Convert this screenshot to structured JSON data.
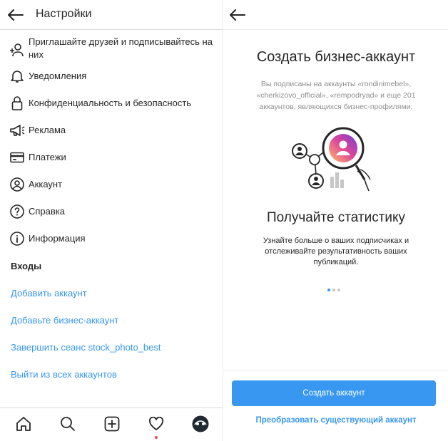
{
  "settings": {
    "title": "Настройки",
    "menu": [
      {
        "label": "Приглашайте друзей и подписывайтесь на них",
        "icon": "add-person-icon"
      },
      {
        "label": "Уведомления",
        "icon": "bell-icon"
      },
      {
        "label": "Конфиденциальность и безопасность",
        "icon": "lock-icon"
      },
      {
        "label": "Реклама",
        "icon": "megaphone-icon"
      },
      {
        "label": "Платежи",
        "icon": "card-icon"
      },
      {
        "label": "Аккаунт",
        "icon": "account-icon"
      },
      {
        "label": "Справка",
        "icon": "help-icon"
      },
      {
        "label": "Информация",
        "icon": "info-icon"
      }
    ],
    "logins_title": "Входы",
    "links": [
      "Добавить аккаунт",
      "Добавьте бизнес-аккаунт",
      "Завершить сеанс stock_photo_best",
      "Выйти из всех аккаунтов"
    ]
  },
  "bottom_nav": [
    {
      "name": "home-icon"
    },
    {
      "name": "search-icon"
    },
    {
      "name": "add-post-icon"
    },
    {
      "name": "heart-icon"
    },
    {
      "name": "profile-avatar"
    }
  ],
  "business": {
    "title": "Создать бизнес-аккаунт",
    "description": "Вы подписаны на аккаунты «rondinimebel», «cherkizovo_official», «rempodryad» и еще 201 аккаунтов, являющихся бизнес-профилями.",
    "subtitle": "Получайте статистику",
    "subdescription": "Узнайте больше о ваших подписчиках и отслеживайте результативность ваших публикаций.",
    "pager": {
      "pages": 3,
      "active": 1
    },
    "create_button": "Создать аккаунт",
    "convert_link": "Преобразовать существующий аккаунт"
  },
  "colors": {
    "accent": "#3897f0",
    "text": "#262626",
    "muted": "#8e8e8e",
    "divider": "#dbdbdb",
    "notification": "#ed4956"
  }
}
